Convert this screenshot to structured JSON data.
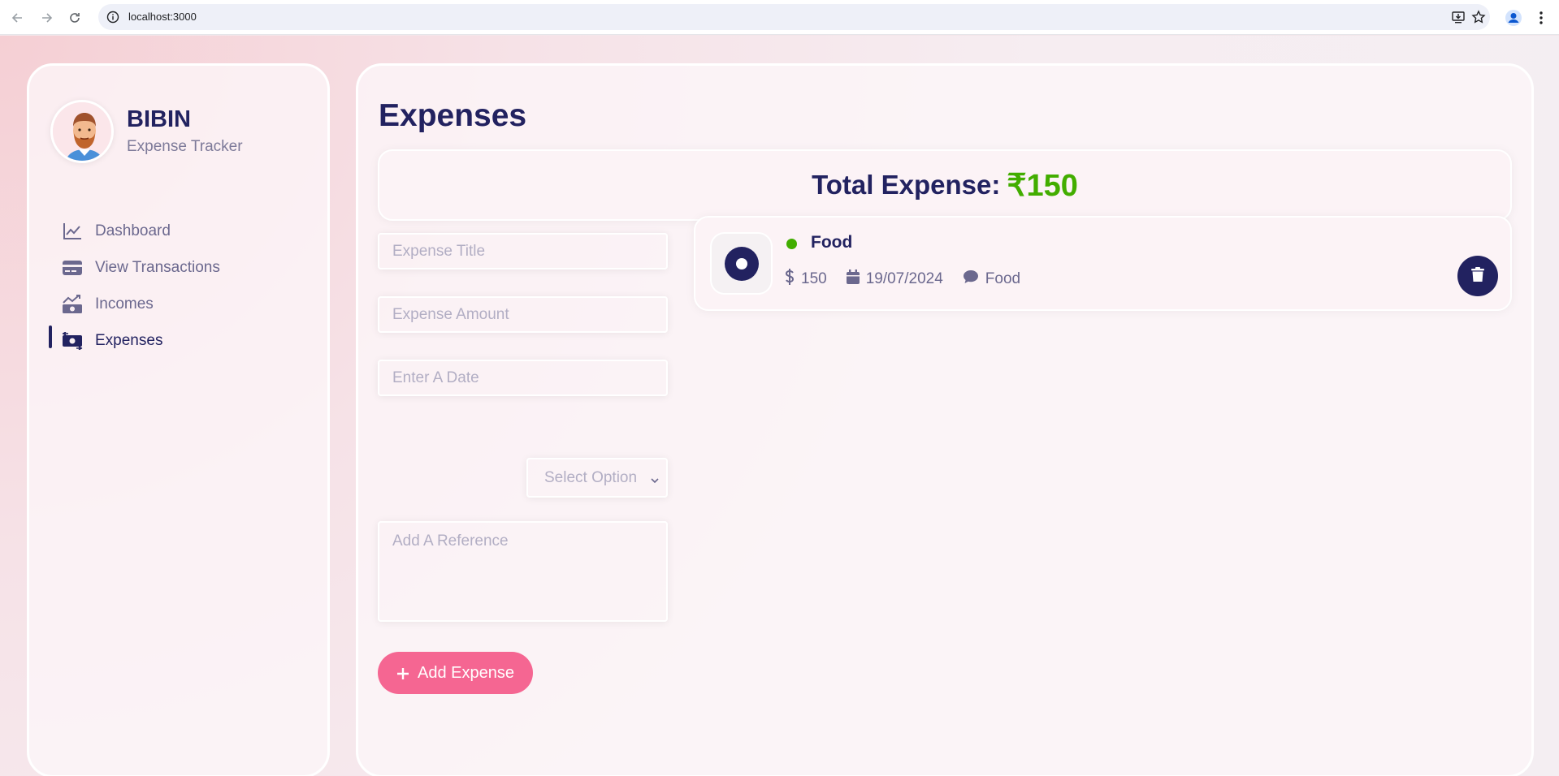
{
  "browser": {
    "url": "localhost:3000"
  },
  "user": {
    "name": "BIBIN",
    "subtitle": "Expense Tracker"
  },
  "menu": {
    "items": [
      {
        "label": "Dashboard",
        "icon": "chart-line-icon"
      },
      {
        "label": "View Transactions",
        "icon": "credit-card-icon"
      },
      {
        "label": "Incomes",
        "icon": "money-bill-trend-up-icon"
      },
      {
        "label": "Expenses",
        "icon": "money-bill-transfer-icon",
        "active": true
      }
    ]
  },
  "page": {
    "title": "Expenses",
    "total_label": "Total Expense:",
    "total_amount": "₹150"
  },
  "form": {
    "title_placeholder": "Expense Title",
    "amount_placeholder": "Expense Amount",
    "date_placeholder": "Enter A Date",
    "select_value": "Select Option",
    "reference_placeholder": "Add A Reference",
    "add_button_label": "Add Expense"
  },
  "expenses": [
    {
      "title": "Food",
      "amount": "150",
      "date": "19/07/2024",
      "description": "Food",
      "status_color": "#42ad00"
    }
  ],
  "colors": {
    "primary": "#222260",
    "accent": "#f56692",
    "success": "#42ad00"
  }
}
